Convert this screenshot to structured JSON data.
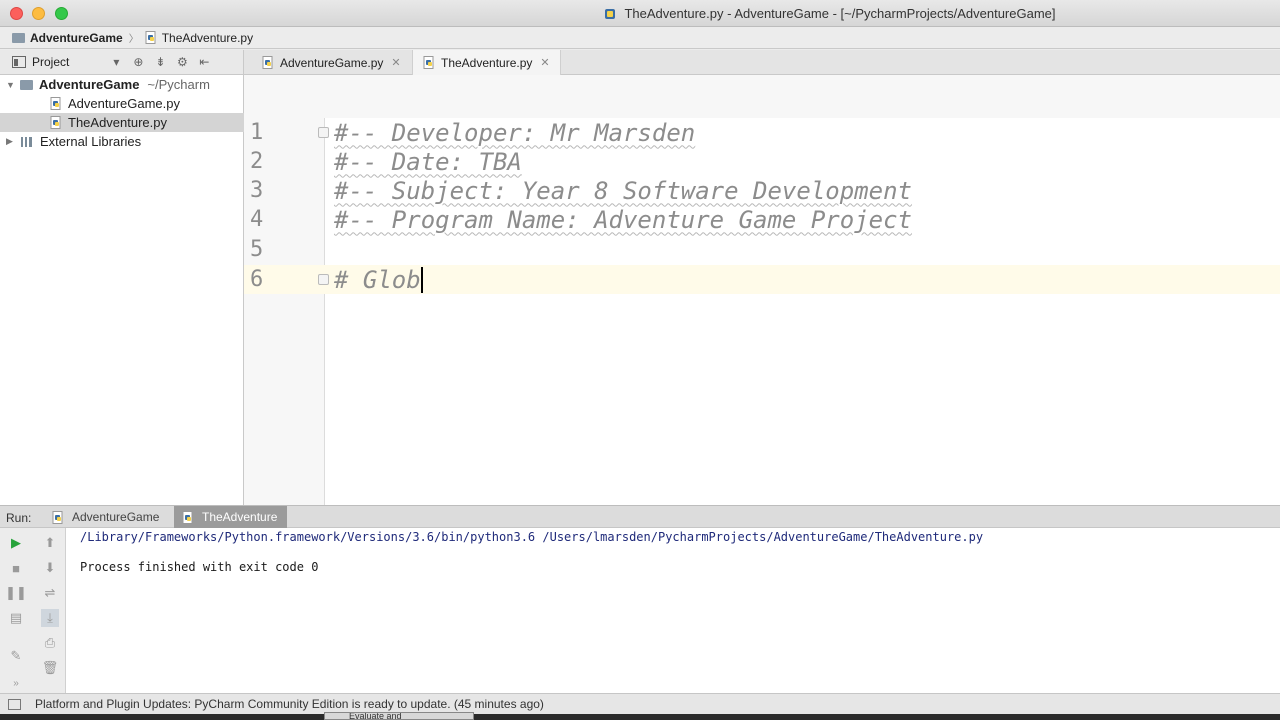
{
  "window": {
    "title": "TheAdventure.py - AdventureGame - [~/PycharmProjects/AdventureGame]"
  },
  "breadcrumb": {
    "project": "AdventureGame",
    "file": "TheAdventure.py"
  },
  "project_panel": {
    "label": "Project",
    "root_name": "AdventureGame",
    "root_path": "~/Pycharm",
    "files": [
      {
        "name": "AdventureGame.py",
        "selected": false
      },
      {
        "name": "TheAdventure.py",
        "selected": true
      }
    ],
    "external": "External Libraries"
  },
  "editor_tabs": [
    {
      "label": "AdventureGame.py",
      "active": false
    },
    {
      "label": "TheAdventure.py",
      "active": true
    }
  ],
  "editor": {
    "lines": [
      {
        "num": "1",
        "text": "#-- Developer: Mr Marsden"
      },
      {
        "num": "2",
        "text": "#-- Date: TBA"
      },
      {
        "num": "3",
        "text": "#-- Subject: Year 8 Software Development"
      },
      {
        "num": "4",
        "text": "#-- Program Name: Adventure Game Project"
      },
      {
        "num": "5",
        "text": ""
      },
      {
        "num": "6",
        "text": "# Glob"
      }
    ],
    "current_line": 6
  },
  "run_panel": {
    "label": "Run:",
    "tabs": [
      {
        "label": "AdventureGame",
        "active": false
      },
      {
        "label": "TheAdventure",
        "active": true
      }
    ],
    "output": [
      "/Library/Frameworks/Python.framework/Versions/3.6/bin/python3.6 /Users/lmarsden/PycharmProjects/AdventureGame/TheAdventure.py",
      "Process finished with exit code 0"
    ]
  },
  "status": {
    "message": "Platform and Plugin Updates: PyCharm Community Edition is ready to update. (45 minutes ago)"
  },
  "background_window": {
    "peek_text": "Evaluate and"
  },
  "colors": {
    "comment": "#8c8c8c",
    "current_line": "#fffbe9",
    "selection": "#d4d4d4",
    "close": "#fc605c",
    "minimize": "#fdbc40",
    "zoom": "#34c84a"
  }
}
